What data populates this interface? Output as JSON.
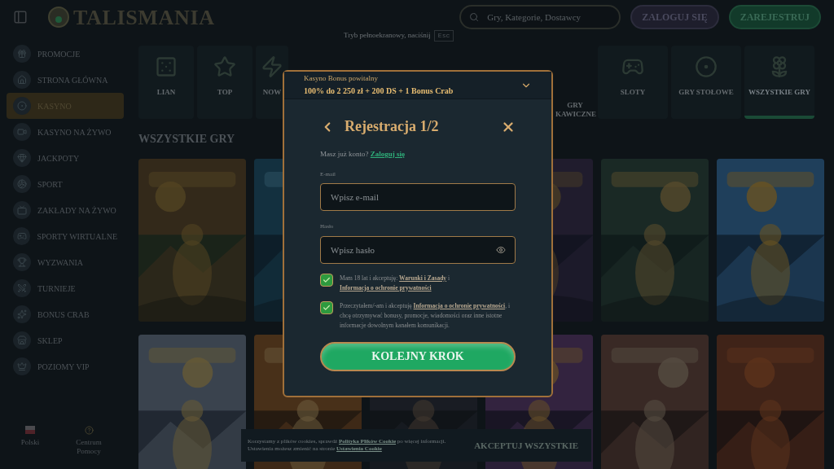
{
  "header": {
    "logo": "TALISMANIA",
    "search": {
      "placeholder": "Gry, Kategorie, Dostawcy"
    },
    "login": "ZALOGUJ SIĘ",
    "register": "ZAREJESTRUJ"
  },
  "fullscreen_hint": {
    "text": "Tryb pełnoekranowy, naciśnij",
    "key": "Esc"
  },
  "sidebar": {
    "items": [
      {
        "label": "PROMOCJE",
        "selected": false
      },
      {
        "label": "STRONA GŁÓWNA",
        "selected": false
      },
      {
        "label": "KASYNO",
        "selected": true
      },
      {
        "label": "KASYNO NA ŻYWO",
        "selected": false
      },
      {
        "label": "JACKPOTY",
        "selected": false
      },
      {
        "label": "SPORT",
        "selected": false
      },
      {
        "label": "ZAKŁADY NA ŻYWO",
        "selected": false
      },
      {
        "label": "SPORTY WIRTUALNE",
        "selected": false
      },
      {
        "label": "WYZWANIA",
        "selected": false
      },
      {
        "label": "TURNIEJE",
        "selected": false
      },
      {
        "label": "BONUS CRAB",
        "selected": false
      },
      {
        "label": "SKLEP",
        "selected": false
      },
      {
        "label": "POZIOMY VIP",
        "selected": false
      }
    ],
    "language": "Polski",
    "help": "Centrum Pomocy"
  },
  "categories": [
    {
      "label": "LIAN",
      "selected": false
    },
    {
      "label": "TOP",
      "selected": false
    },
    {
      "label": "NOW",
      "selected": false
    },
    {
      "label": "GRY KAWICZNE",
      "selected": false
    },
    {
      "label": "SLOTY",
      "selected": false
    },
    {
      "label": "GRY STOŁOWE",
      "selected": false
    },
    {
      "label": "WSZYSTKIE GRY",
      "selected": true
    }
  ],
  "section_title": "WSZYSTKIE GRY",
  "modal": {
    "bonus_label": "Kasyno Bonus powitalny",
    "bonus_offer": "100% do 2 250 zł + 200 DS + 1 Bonus Crab",
    "title": "Rejestracja 1/2",
    "account_prompt": "Masz już konto?",
    "login_link": "Zaloguj się",
    "email": {
      "label": "E-mail",
      "placeholder": "Wpisz e-mail"
    },
    "password": {
      "label": "Hasło",
      "placeholder": "Wpisz hasło"
    },
    "consents": [
      {
        "checked": true,
        "parts": [
          {
            "kind": "text",
            "text": "Mam 18 lat i akceptuję: "
          },
          {
            "kind": "link",
            "text": "Warunki i Zasady"
          },
          {
            "kind": "text",
            "text": " i "
          },
          {
            "kind": "link",
            "text": "Informacja o ochronie prywatności"
          }
        ]
      },
      {
        "checked": true,
        "parts": [
          {
            "kind": "text",
            "text": "Przeczytałem/-am i akceptuję "
          },
          {
            "kind": "link",
            "text": "Informacja o ochronie prywatności"
          },
          {
            "kind": "text",
            "text": ", i chcę otrzymywać bonusy, promocje, wiadomości oraz inne istotne informacje dowolnym kanałem komunikacji."
          }
        ]
      }
    ],
    "submit": "KOLEJNY KROK"
  },
  "cookie_bar": {
    "parts": [
      {
        "kind": "text",
        "text": "Korzystamy z plików cookies, sprawdź "
      },
      {
        "kind": "link",
        "text": "Polityka Plików Cookie"
      },
      {
        "kind": "text",
        "text": " po więcej informacji. Ustawienia możesz zmienić na stronie "
      },
      {
        "kind": "link",
        "text": "Ustawienia Cookie"
      }
    ],
    "accept": "AKCEPTUJ WSZYSTKIE"
  }
}
